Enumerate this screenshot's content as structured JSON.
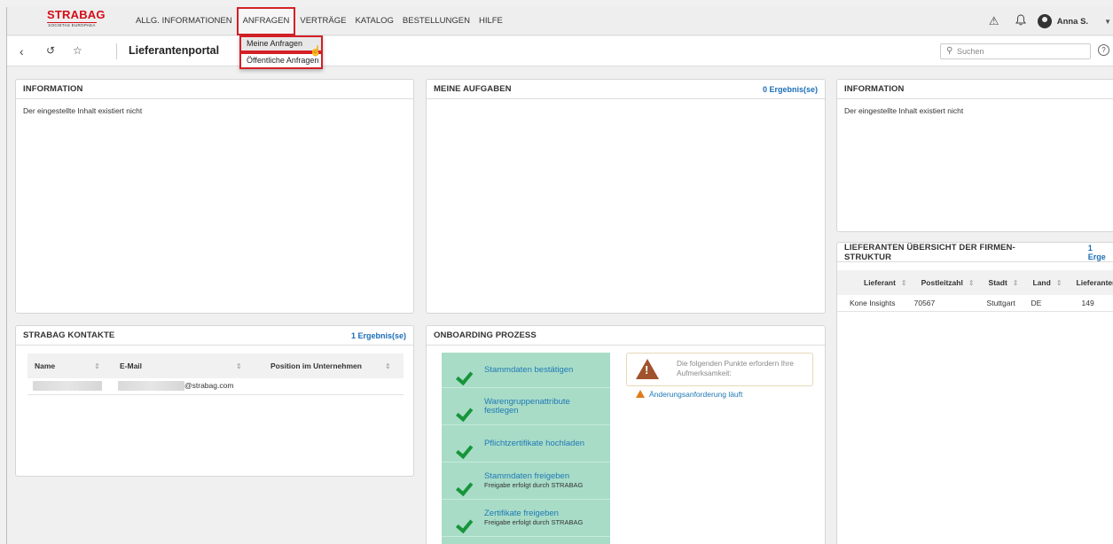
{
  "topbar": {
    "logo_brand": "STRABAG",
    "logo_sub": "SOCIETAS EUROPAEA",
    "menu": [
      {
        "label": "ALLG. INFORMATIONEN",
        "active": false
      },
      {
        "label": "ANFRAGEN",
        "active": true
      },
      {
        "label": "VERTRÄGE",
        "active": false
      },
      {
        "label": "KATALOG",
        "active": false
      },
      {
        "label": "BESTELLUNGEN",
        "active": false
      },
      {
        "label": "HILFE",
        "active": false
      }
    ],
    "username": "Anna S.",
    "icons": [
      "warning-icon",
      "bell-icon",
      "user-avatar-icon",
      "caret-down-icon"
    ]
  },
  "dropdown": {
    "items": [
      "Meine Anfragen",
      "Öffentliche Anfragen"
    ]
  },
  "subbar": {
    "title": "Lieferantenportal",
    "search_placeholder": "Suchen"
  },
  "panels": {
    "info_left": {
      "title": "INFORMATION",
      "text": "Der eingestellte Inhalt existiert nicht"
    },
    "tasks": {
      "title": "MEINE AUFGABEN",
      "count": "0 Ergebnis(se)"
    },
    "info_right": {
      "title": "INFORMATION",
      "text": "Der eingestellte Inhalt existiert nicht"
    },
    "contacts": {
      "title": "STRABAG KONTAKTE",
      "count": "1 Ergebnis(se)",
      "columns": [
        "Name",
        "E-Mail",
        "Position im Unternehmen"
      ],
      "rows": [
        {
          "email": "@strabag.com"
        }
      ]
    },
    "onboarding": {
      "title": "ONBOARDING PROZESS",
      "steps": [
        {
          "title": "Stammdaten bestätigen",
          "sub": ""
        },
        {
          "title": "Warengruppenattribute festlegen",
          "sub": ""
        },
        {
          "title": "Pflichtzertifikate hochladen",
          "sub": ""
        },
        {
          "title": "Stammdaten freigeben",
          "sub": "Freigabe erfolgt durch STRABAG"
        },
        {
          "title": "Zertifikate freigeben",
          "sub": "Freigabe erfolgt durch STRABAG"
        }
      ],
      "alert_text": "Die folgenden Punkte erfordern Ihre Aufmerksamkeit:",
      "alert_item": "Änderungsanforderung läuft"
    },
    "suppliers": {
      "title": "LIEFERANTEN ÜBERSICHT DER FIRMEN-STRUKTUR",
      "count": "1 Erge",
      "columns": [
        "Lieferant",
        "Postleitzahl",
        "Stadt",
        "Land",
        "Lieferantenco"
      ],
      "rows": [
        [
          "Kone Insights",
          "70567",
          "Stuttgart",
          "DE",
          "149"
        ]
      ]
    }
  },
  "colors": {
    "accent_red": "#d42027",
    "link_blue": "#1b6fb8",
    "step_green": "#a8dcc7",
    "check_green": "#17953a"
  }
}
